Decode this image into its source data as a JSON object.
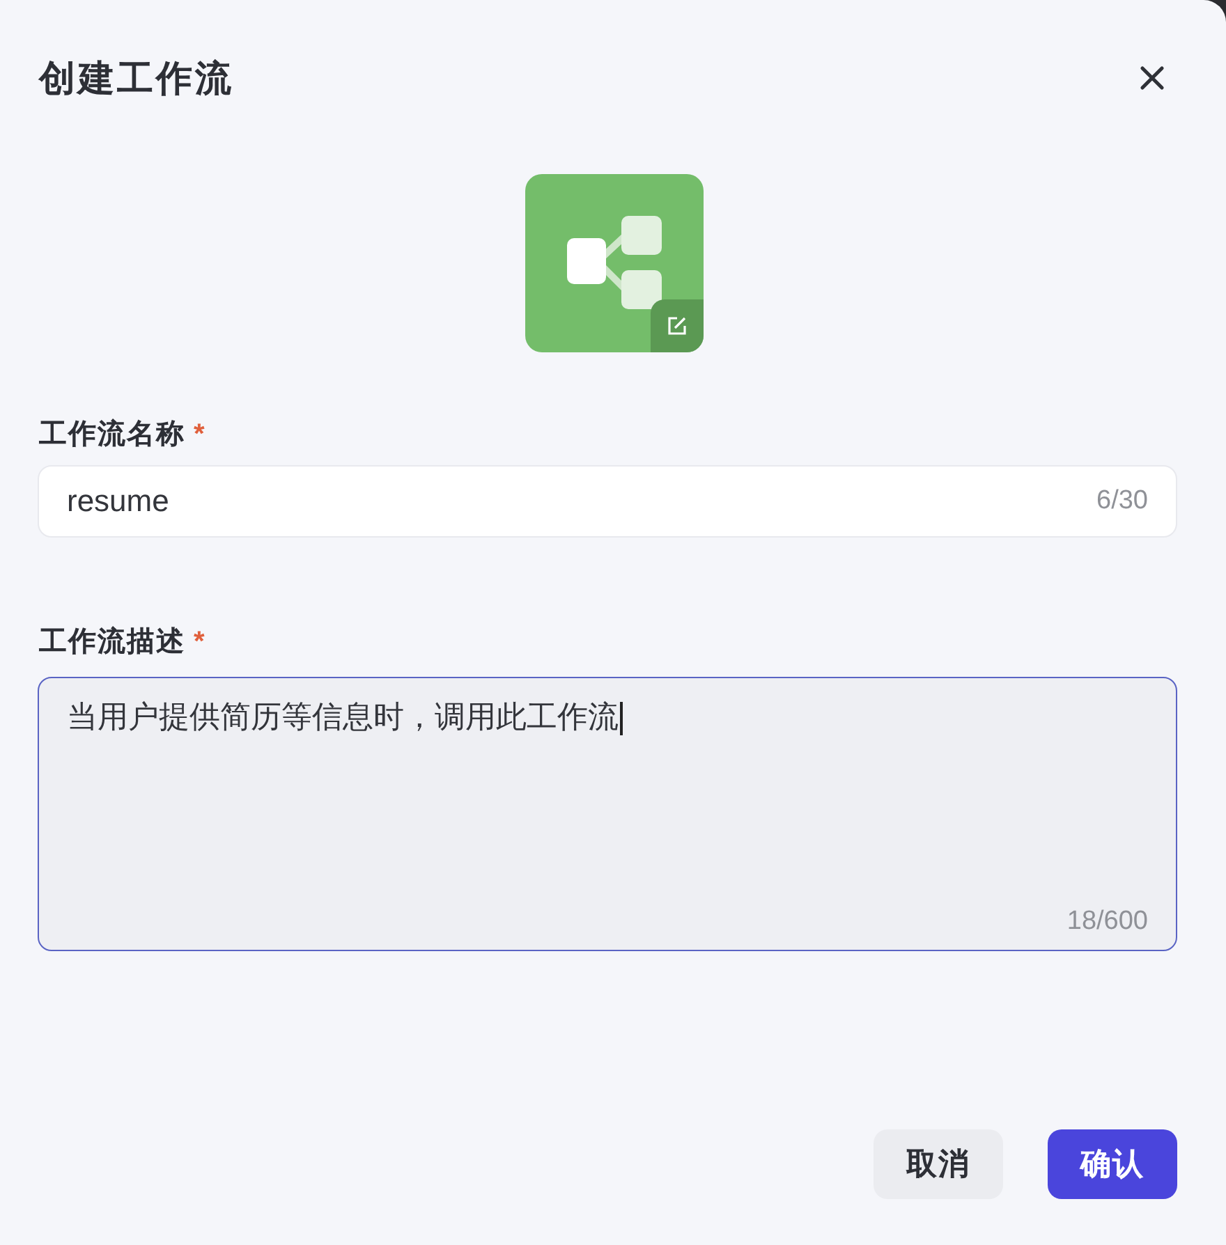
{
  "dialog": {
    "title": "创建工作流"
  },
  "fields": [
    {
      "kind": "input",
      "label": "工作流名称",
      "required_mark": "*",
      "value": "resume",
      "counter": "6/30",
      "focused": false
    },
    {
      "kind": "textarea",
      "label": "工作流描述",
      "required_mark": "*",
      "value": "当用户提供简历等信息时，调用此工作流",
      "counter": "18/600",
      "focused": true
    }
  ],
  "buttons": [
    {
      "label": "取消",
      "kind": "secondary"
    },
    {
      "label": "确认",
      "kind": "primary"
    }
  ]
}
